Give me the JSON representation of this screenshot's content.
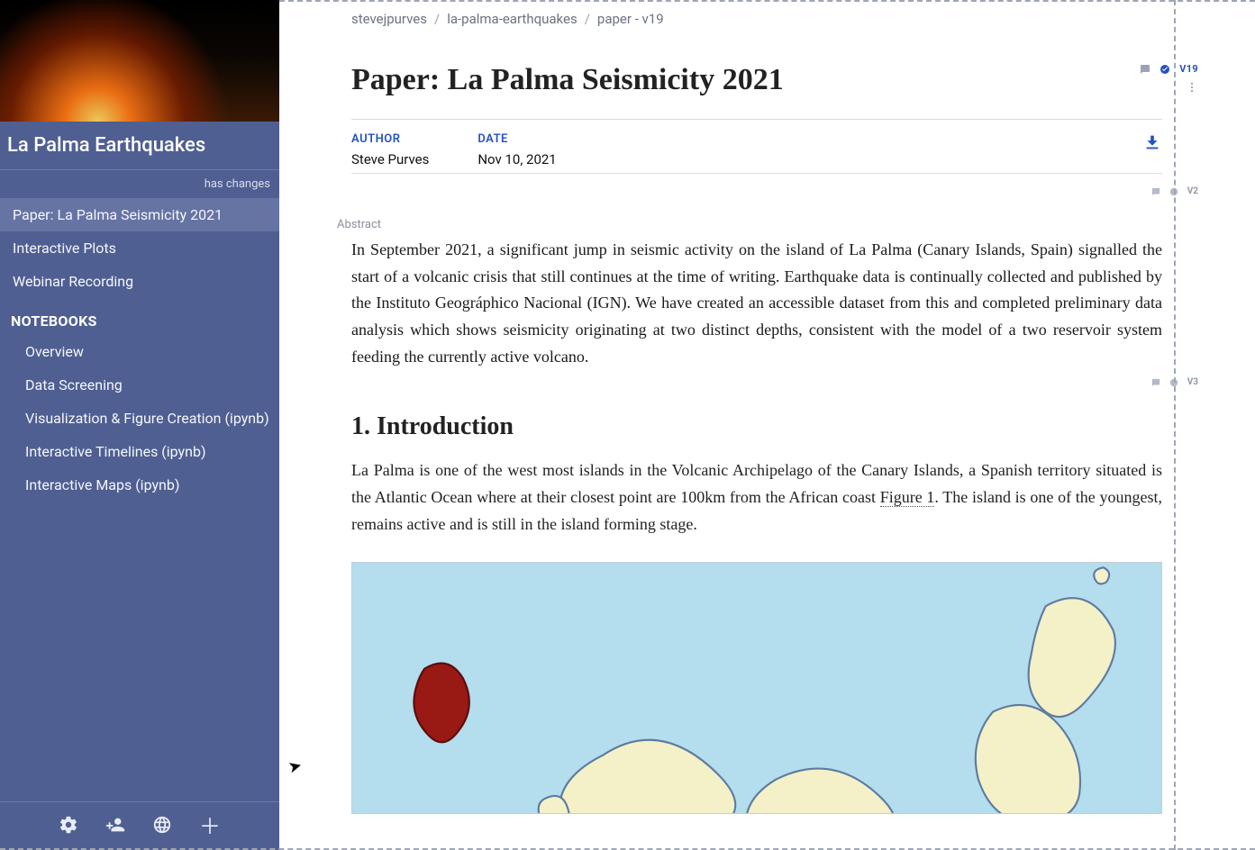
{
  "sidebar": {
    "project_title": "La Palma Earthquakes",
    "status": "has changes",
    "items": [
      {
        "label": "Paper: La Palma Seismicity 2021",
        "active": true
      },
      {
        "label": "Interactive Plots",
        "active": false
      },
      {
        "label": "Webinar Recording",
        "active": false
      }
    ],
    "section_label": "NOTEBOOKS",
    "notebooks": [
      {
        "label": "Overview"
      },
      {
        "label": "Data Screening"
      },
      {
        "label": "Visualization & Figure Creation (ipynb)"
      },
      {
        "label": "Interactive Timelines (ipynb)"
      },
      {
        "label": "Interactive Maps (ipynb)"
      }
    ],
    "footer_icons": [
      "gear-icon",
      "share-person-icon",
      "globe-icon",
      "plus-icon"
    ]
  },
  "breadcrumb": {
    "parts": [
      "stevejpurves",
      "la-palma-earthquakes",
      "paper - v19"
    ]
  },
  "paper": {
    "title": "Paper: La Palma Seismicity 2021",
    "version_badge": "V19",
    "author_label": "AUTHOR",
    "author": "Steve Purves",
    "date_label": "DATE",
    "date": "Nov 10, 2021",
    "abstract_label": "Abstract",
    "abstract": "In September 2021, a significant jump in seismic activity on the island of La Palma (Canary Islands, Spain) signalled the start of a volcanic crisis that still continues at the time of writing. Earthquake data is continually collected and published by the Instituto Geográphico Nacional (IGN). We have created an accessible dataset from this and completed preliminary data analysis which shows seismicity originating at two distinct depths, consistent with the model of a two reservoir system feeding the currently active volcano.",
    "block_v2": "V2",
    "section1_title": "1.  Introduction",
    "intro_pre": "La Palma is one of the west most islands in the Volcanic Archipelago of the Canary Islands, a Spanish territory situated is the Atlantic Ocean where at their closest point are 100km from the African coast ",
    "figref": "Figure 1",
    "intro_post": ". The island is one of the youngest, remains active and is still in the island forming stage.",
    "block_v3": "V3"
  },
  "colors": {
    "sidebar_bg": "#4f5f92",
    "accent": "#2552bf",
    "ocean": "#b4dded",
    "island_fill": "#f4f0c8",
    "island_stroke": "#5e7ca0",
    "lapalma": "#991914"
  }
}
